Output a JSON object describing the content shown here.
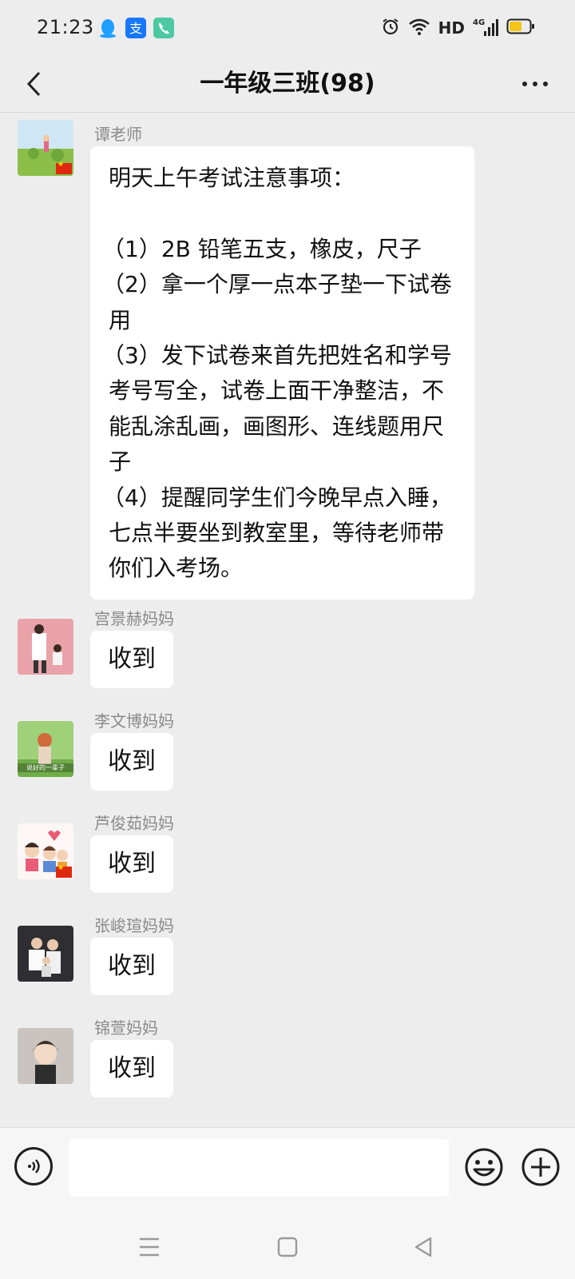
{
  "status_bar": {
    "time": "21:23",
    "network_label": "HD",
    "signal_label": "4G",
    "app_icons": [
      "qq-penguin-icon",
      "alipay-icon",
      "phone-icon"
    ]
  },
  "header": {
    "title": "一年级三班(98)"
  },
  "messages": [
    {
      "sender": "谭老师",
      "lines": [
        "明天上午考试注意事项：",
        "",
        "（1）2B 铅笔五支，橡皮，尺子",
        "（2）拿一个厚一点本子垫一下试卷",
        "用",
        "（3）发下试卷来首先把姓名和学号",
        "考号写全，试卷上面干净整洁，不",
        "能乱涂乱画，画图形、连线题用尺",
        "子",
        "（4）提醒同学生们今晚早点入睡，",
        "七点半要坐到教室里，等待老师带",
        "你们入考场。"
      ]
    },
    {
      "sender": "宫景赫妈妈",
      "text": "收到"
    },
    {
      "sender": "李文博妈妈",
      "text": "收到",
      "avatar_caption": "说好的一辈子"
    },
    {
      "sender": "芦俊茹妈妈",
      "text": "收到"
    },
    {
      "sender": "张峻瑄妈妈",
      "text": "收到"
    },
    {
      "sender": "锦萱妈妈",
      "text": "收到"
    }
  ],
  "input": {
    "placeholder": ""
  },
  "colors": {
    "background": "#ededed",
    "bubble": "#ffffff",
    "sender_name": "#8a8a8a",
    "battery": "#f5c518",
    "flag_red": "#de2910"
  }
}
